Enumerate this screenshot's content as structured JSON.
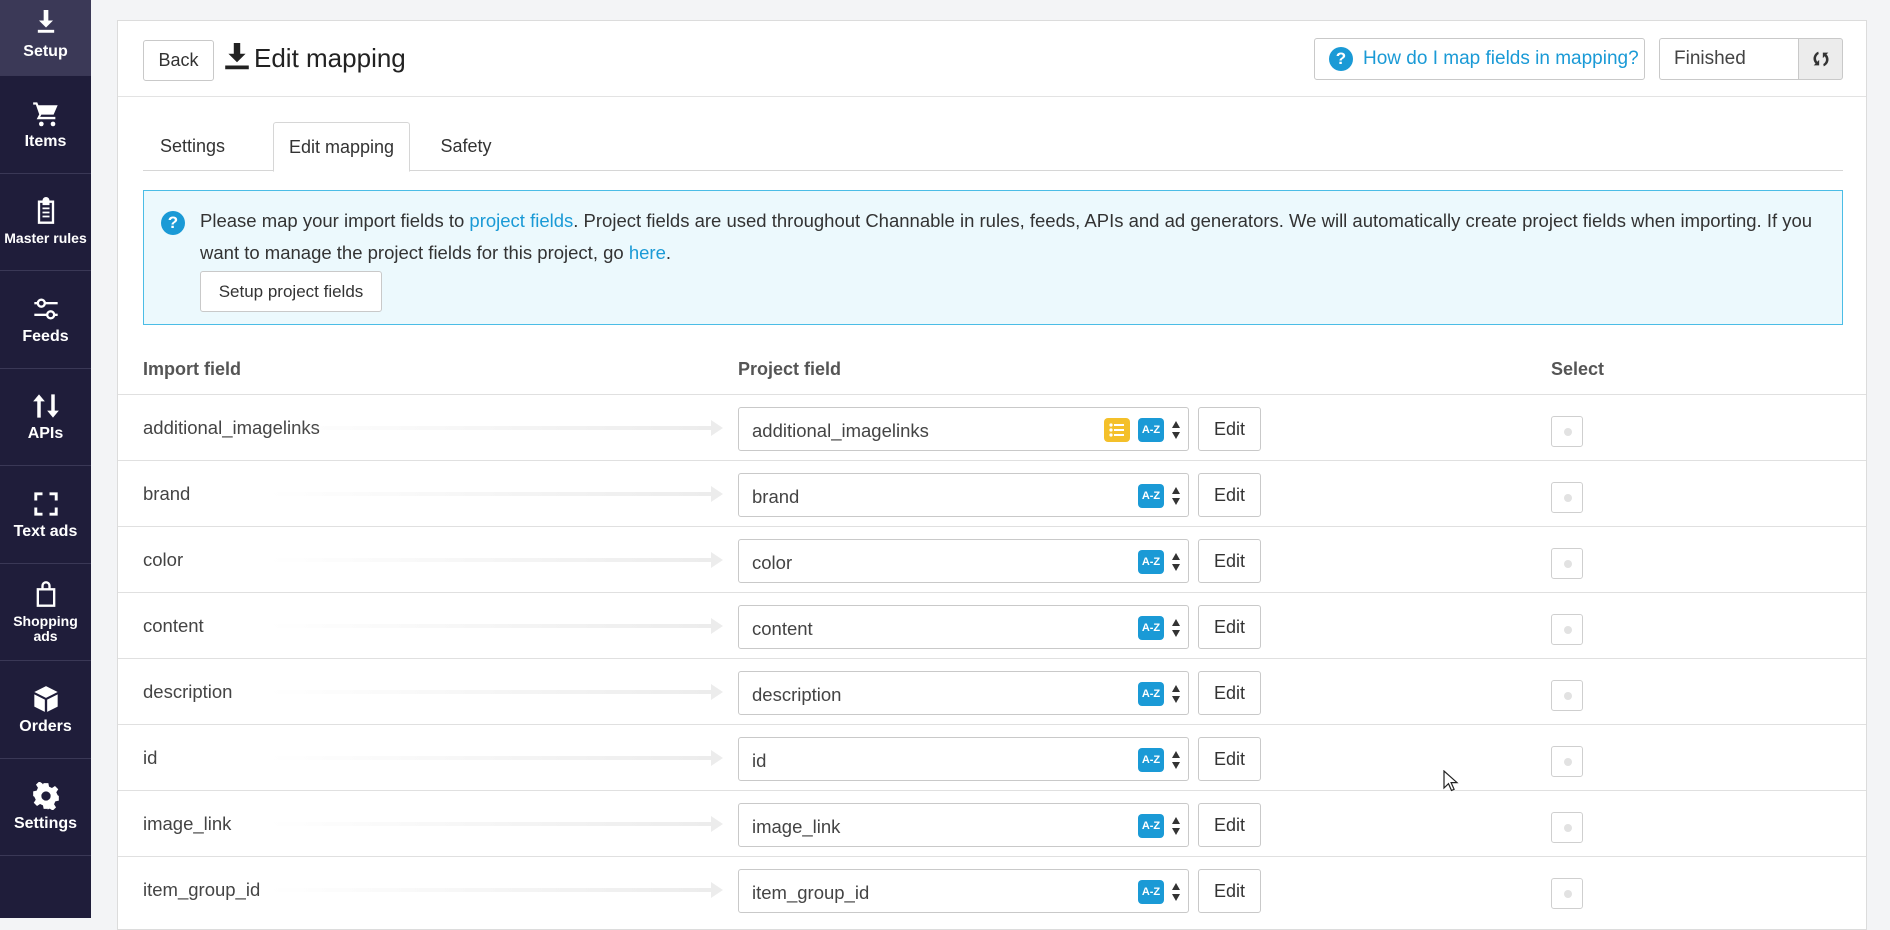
{
  "sidebar": {
    "items": [
      {
        "label": "Setup",
        "icon": "download-icon"
      },
      {
        "label": "Items",
        "icon": "cart-icon"
      },
      {
        "label": "Master rules",
        "icon": "clipboard-icon"
      },
      {
        "label": "Feeds",
        "icon": "sliders-icon"
      },
      {
        "label": "APIs",
        "icon": "up-down-arrows-icon"
      },
      {
        "label": "Text ads",
        "icon": "frame-corners-icon"
      },
      {
        "label": "Shopping ads",
        "icon": "shopping-bag-icon"
      },
      {
        "label": "Orders",
        "icon": "box-icon"
      },
      {
        "label": "Settings",
        "icon": "gear-icon"
      }
    ]
  },
  "header": {
    "back_label": "Back",
    "title": "Edit mapping",
    "help_label": "How do I map fields in mapping?",
    "status": "Finished"
  },
  "tabs": [
    {
      "label": "Settings"
    },
    {
      "label": "Edit mapping"
    },
    {
      "label": "Safety"
    }
  ],
  "info": {
    "text1": "Please map your import fields to ",
    "link1": "project fields",
    "text2": ". Project fields are used throughout Channable in rules, feeds, APIs and ad generators. We will automatically create project fields when importing. If you want to manage the project fields for this project, go ",
    "link2": "here",
    "text3": ".",
    "button_label": "Setup project fields"
  },
  "table": {
    "headers": [
      "Import field",
      "Project field",
      "Select"
    ],
    "edit_label": "Edit",
    "az_label": "A-Z",
    "rows": [
      {
        "import": "additional_imagelinks",
        "project": "additional_imagelinks",
        "list": true
      },
      {
        "import": "brand",
        "project": "brand"
      },
      {
        "import": "color",
        "project": "color"
      },
      {
        "import": "content",
        "project": "content"
      },
      {
        "import": "description",
        "project": "description"
      },
      {
        "import": "id",
        "project": "id"
      },
      {
        "import": "image_link",
        "project": "image_link"
      },
      {
        "import": "item_group_id",
        "project": "item_group_id"
      }
    ]
  },
  "colors": {
    "sidebar_bg": "#1f1d3a",
    "accent": "#1a9ad6",
    "list_badge": "#f4c02a"
  }
}
